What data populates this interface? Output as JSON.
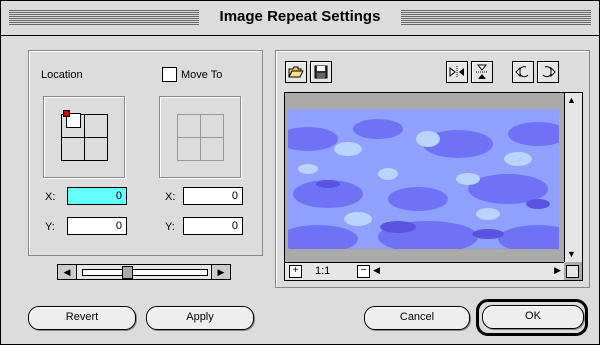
{
  "window": {
    "title": "Image Repeat Settings"
  },
  "location": {
    "label": "Location",
    "x_label": "X:",
    "y_label": "Y:",
    "x_value": "0",
    "y_value": "0"
  },
  "move_to": {
    "checkbox_label": "Move To",
    "checked": false,
    "x_label": "X:",
    "y_label": "Y:",
    "x_value": "0",
    "y_value": "0"
  },
  "slider": {
    "value_fraction": 0.35
  },
  "preview": {
    "zoom_label": "1:1",
    "toolbar_icons": [
      "folder-open-icon",
      "save-disk-icon",
      "flip-horizontal-icon",
      "flip-vertical-icon",
      "rotate-left-icon",
      "rotate-right-icon"
    ],
    "pattern_color": "#7f8cff"
  },
  "buttons": {
    "revert": "Revert",
    "apply": "Apply",
    "cancel": "Cancel",
    "ok": "OK"
  }
}
